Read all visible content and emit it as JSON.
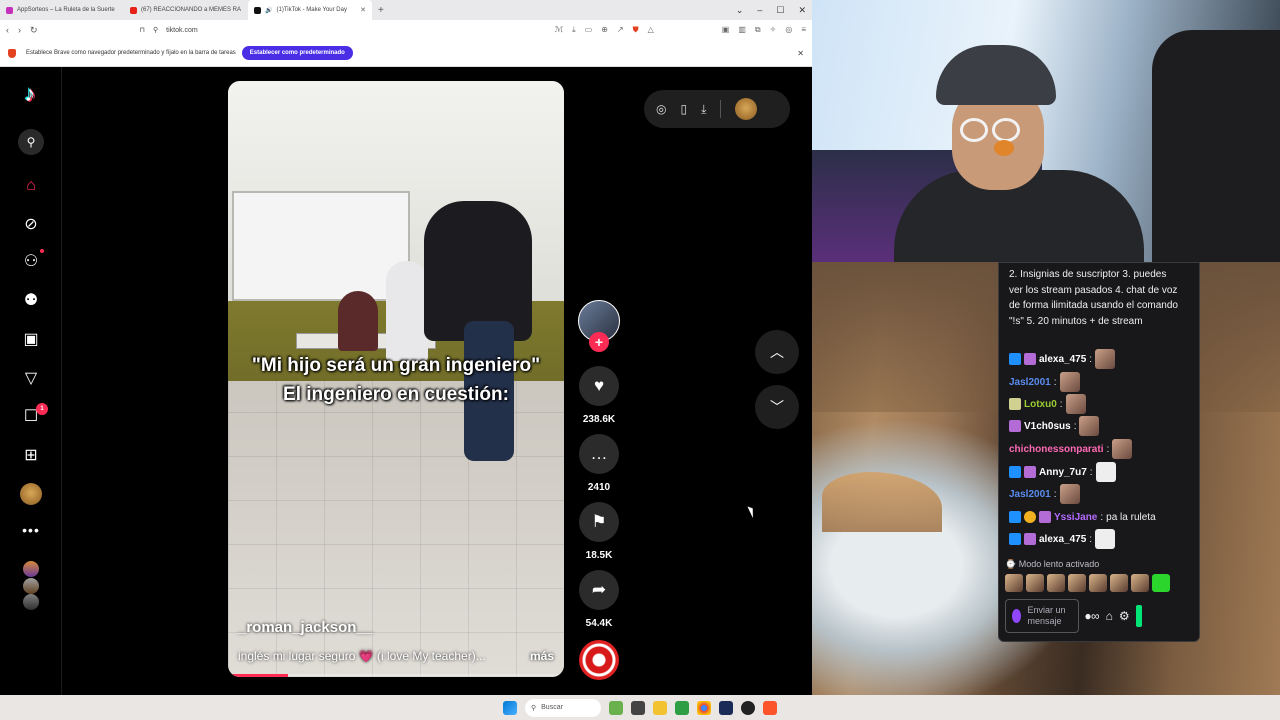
{
  "browser": {
    "tabs": [
      {
        "title": "AppSorteos – La Ruleta de la Suerte",
        "color": "#c42fbb"
      },
      {
        "title": "(67) REACCIONANDO a MEMES RA",
        "color": "#e62117"
      },
      {
        "title": "(1)TikTok - Make Your Day",
        "color": "#111111"
      }
    ],
    "url": "tiktok.com",
    "infobar_text": "Establece Brave como navegador predeterminado y fíjalo en la barra de tareas",
    "infobar_button": "Establecer como predeterminado"
  },
  "tiktok": {
    "nav_icons": [
      "tiktok-logo-icon",
      "search-icon",
      "home-icon",
      "explore-icon",
      "following-icon",
      "friends-icon",
      "live-icon",
      "messages-icon",
      "inbox-icon",
      "upload-icon",
      "profile-icon",
      "more-icon"
    ],
    "inbox_badge": "1",
    "video": {
      "overlay_line1": "\"Mi hijo será un gran ingeniero\"",
      "overlay_line2": "El ingeniero en cuestión:",
      "username": "_roman_jackson__",
      "caption": "inglés mi lugar seguro 💗 (i love My teacher)...",
      "more": "más",
      "progress": 0.18
    },
    "actions": {
      "likes": "238.6K",
      "comments": "2410",
      "saves": "18.5K",
      "shares": "54.4K"
    }
  },
  "chat": {
    "system_text": "2. Insignias de suscriptor 3. puedes ver los stream pasados 4. chat de voz de forma ilimitada usando el comando \"!s\" 5. 20 minutos + de stream",
    "messages": [
      {
        "user": "alexa_475",
        "color": "#ffffff",
        "text": ""
      },
      {
        "user": "Jasl2001",
        "color": "#5b8def",
        "text": ""
      },
      {
        "user": "Lotxu0",
        "color": "#9acd32",
        "text": ""
      },
      {
        "user": "V1ch0sus",
        "color": "#ffffff",
        "text": ""
      },
      {
        "user": "chichonessonparati",
        "color": "#ff69b4",
        "text": ""
      },
      {
        "user": "Anny_7u7",
        "color": "#ffffff",
        "text": ""
      },
      {
        "user": "Jasl2001",
        "color": "#5b8def",
        "text": ""
      },
      {
        "user": "YssiJane",
        "color": "#b46bff",
        "text": " pa la ruleta"
      },
      {
        "user": "alexa_475",
        "color": "#ffffff",
        "text": ""
      }
    ],
    "slow_mode": "Modo lento activado",
    "input_placeholder": "Enviar un mensaje"
  },
  "taskbar": {
    "search_label": "Buscar"
  }
}
